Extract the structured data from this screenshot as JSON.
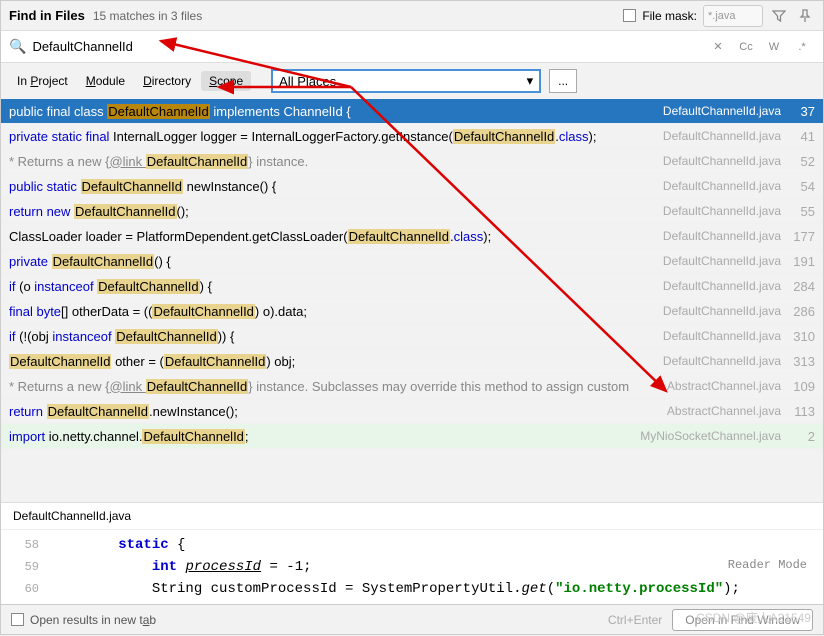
{
  "header": {
    "title": "Find in Files",
    "subtitle": "15 matches in 3 files",
    "file_mask_label": "File mask:",
    "file_mask_value": "*.java"
  },
  "search": {
    "query": "DefaultChannelId",
    "tools": {
      "cc": "Cc",
      "w": "W",
      "regex": ".*",
      "close": "✕"
    }
  },
  "scope": {
    "tabs": [
      "In Project",
      "Module",
      "Directory",
      "Scope"
    ],
    "active_index": 3,
    "dropdown": "All Places",
    "dots": "..."
  },
  "results": [
    {
      "selected": true,
      "parts": [
        {
          "t": "public final class ",
          "c": ""
        },
        {
          "t": "DefaultChannelId",
          "c": "hl"
        },
        {
          "t": " implements ChannelId {",
          "c": ""
        }
      ],
      "file": "DefaultChannelId.java",
      "line": "37"
    },
    {
      "parts": [
        {
          "t": "private static final ",
          "c": "kw-blue"
        },
        {
          "t": "InternalLogger logger = InternalLoggerFactory.getInstance(",
          "c": ""
        },
        {
          "t": "DefaultChannelId",
          "c": "hl"
        },
        {
          "t": ".",
          "c": ""
        },
        {
          "t": "class",
          "c": "kw-blue"
        },
        {
          "t": ");",
          "c": ""
        }
      ],
      "file": "DefaultChannelId.java",
      "line": "41"
    },
    {
      "parts": [
        {
          "t": "* Returns a new {",
          "c": "kw-gray"
        },
        {
          "t": "@link ",
          "c": "kw-gray ul"
        },
        {
          "t": "DefaultChannelId",
          "c": "hl"
        },
        {
          "t": "} instance.",
          "c": "kw-gray"
        }
      ],
      "file": "DefaultChannelId.java",
      "line": "52"
    },
    {
      "parts": [
        {
          "t": "public static ",
          "c": "kw-blue"
        },
        {
          "t": "DefaultChannelId",
          "c": "hl"
        },
        {
          "t": " newInstance() {",
          "c": ""
        }
      ],
      "file": "DefaultChannelId.java",
      "line": "54"
    },
    {
      "parts": [
        {
          "t": "return new ",
          "c": "kw-blue"
        },
        {
          "t": "DefaultChannelId",
          "c": "hl"
        },
        {
          "t": "();",
          "c": ""
        }
      ],
      "file": "DefaultChannelId.java",
      "line": "55"
    },
    {
      "parts": [
        {
          "t": "ClassLoader loader = PlatformDependent.getClassLoader(",
          "c": ""
        },
        {
          "t": "DefaultChannelId",
          "c": "hl"
        },
        {
          "t": ".",
          "c": ""
        },
        {
          "t": "class",
          "c": "kw-blue"
        },
        {
          "t": ");",
          "c": ""
        }
      ],
      "file": "DefaultChannelId.java",
      "line": "177"
    },
    {
      "parts": [
        {
          "t": "private ",
          "c": "kw-blue"
        },
        {
          "t": "DefaultChannelId",
          "c": "hl"
        },
        {
          "t": "() {",
          "c": ""
        }
      ],
      "file": "DefaultChannelId.java",
      "line": "191"
    },
    {
      "parts": [
        {
          "t": "if ",
          "c": "kw-blue"
        },
        {
          "t": "(o ",
          "c": ""
        },
        {
          "t": "instanceof ",
          "c": "kw-blue"
        },
        {
          "t": "DefaultChannelId",
          "c": "hl"
        },
        {
          "t": ") {",
          "c": ""
        }
      ],
      "file": "DefaultChannelId.java",
      "line": "284"
    },
    {
      "parts": [
        {
          "t": "final byte",
          "c": "kw-blue"
        },
        {
          "t": "[] otherData = ((",
          "c": ""
        },
        {
          "t": "DefaultChannelId",
          "c": "hl"
        },
        {
          "t": ") o).data;",
          "c": ""
        }
      ],
      "file": "DefaultChannelId.java",
      "line": "286"
    },
    {
      "parts": [
        {
          "t": "if ",
          "c": "kw-blue"
        },
        {
          "t": "(!(obj ",
          "c": ""
        },
        {
          "t": "instanceof ",
          "c": "kw-blue"
        },
        {
          "t": "DefaultChannelId",
          "c": "hl"
        },
        {
          "t": ")) {",
          "c": ""
        }
      ],
      "file": "DefaultChannelId.java",
      "line": "310"
    },
    {
      "parts": [
        {
          "t": "DefaultChannelId",
          "c": "hl"
        },
        {
          "t": " other = (",
          "c": ""
        },
        {
          "t": "DefaultChannelId",
          "c": "hl"
        },
        {
          "t": ") obj;",
          "c": ""
        }
      ],
      "file": "DefaultChannelId.java",
      "line": "313"
    },
    {
      "parts": [
        {
          "t": "* Returns a new {",
          "c": "kw-gray"
        },
        {
          "t": "@link ",
          "c": "kw-gray ul"
        },
        {
          "t": "DefaultChannelId",
          "c": "hl"
        },
        {
          "t": "} instance. Subclasses may override this method to assign custom",
          "c": "kw-gray"
        }
      ],
      "file": "AbstractChannel.java",
      "line": "109"
    },
    {
      "parts": [
        {
          "t": "return ",
          "c": "kw-blue"
        },
        {
          "t": "DefaultChannelId",
          "c": "hl"
        },
        {
          "t": ".newInstance();",
          "c": ""
        }
      ],
      "file": "AbstractChannel.java",
      "line": "113"
    },
    {
      "import": true,
      "parts": [
        {
          "t": "import ",
          "c": "kw-blue"
        },
        {
          "t": "io.netty.channel.",
          "c": ""
        },
        {
          "t": "DefaultChannelId",
          "c": "hl"
        },
        {
          "t": ";",
          "c": ""
        }
      ],
      "file": "MyNioSocketChannel.java",
      "line": "2"
    }
  ],
  "preview": {
    "filename": "DefaultChannelId.java",
    "reader_mode": "Reader Mode",
    "lines": [
      {
        "num": "58",
        "indent": "        ",
        "tokens": [
          {
            "t": "static",
            "c": "code-kw"
          },
          {
            "t": " {",
            "c": ""
          }
        ]
      },
      {
        "num": "59",
        "indent": "            ",
        "tokens": [
          {
            "t": "int",
            "c": "code-kw"
          },
          {
            "t": " ",
            "c": ""
          },
          {
            "t": "processId",
            "c": "code-fn",
            "ul": true
          },
          {
            "t": " = -",
            "c": ""
          },
          {
            "t": "1",
            "c": ""
          },
          {
            "t": ";",
            "c": ""
          }
        ]
      },
      {
        "num": "60",
        "indent": "            ",
        "tokens": [
          {
            "t": "String customProcessId = SystemPropertyUtil.",
            "c": ""
          },
          {
            "t": "get",
            "c": "code-fn"
          },
          {
            "t": "(",
            "c": ""
          },
          {
            "t": "\"io.netty.processId\"",
            "c": "code-str"
          },
          {
            "t": ");",
            "c": ""
          }
        ]
      }
    ]
  },
  "footer": {
    "open_tab_label": "Open results in new tab",
    "hint": "Ctrl+Enter",
    "open_btn": "Open in Find Window",
    "watermark": "CSDN @废人A21549"
  }
}
